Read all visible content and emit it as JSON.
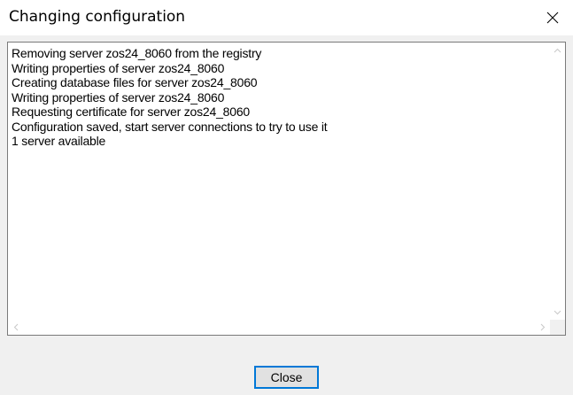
{
  "window": {
    "title": "Changing configuration",
    "close_icon": "close-x-icon"
  },
  "log": {
    "lines": [
      "Removing server zos24_8060 from the registry",
      "Writing properties of server zos24_8060",
      "Creating database files for server zos24_8060",
      "Writing properties of server zos24_8060",
      "Requesting certificate for server zos24_8060",
      "Configuration saved, start server connections to try to use it",
      "1 server available"
    ]
  },
  "scrollbars": {
    "up_icon": "chevron-up-icon",
    "down_icon": "chevron-down-icon",
    "left_icon": "chevron-left-icon",
    "right_icon": "chevron-right-icon"
  },
  "footer": {
    "close_label": "Close"
  },
  "colors": {
    "accent": "#0078d7",
    "window_bg": "#f0f0f0",
    "titlebar_bg": "#ffffff"
  }
}
